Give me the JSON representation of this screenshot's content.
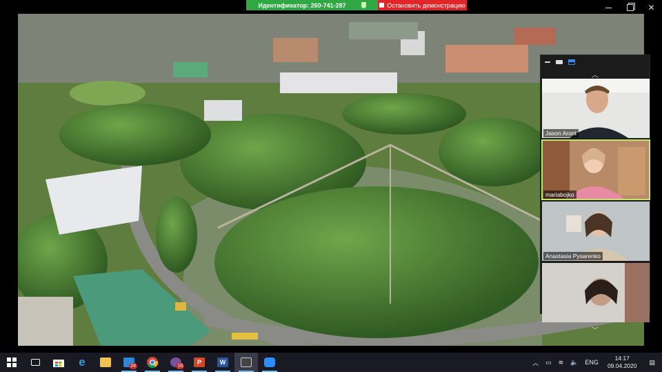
{
  "share_bar": {
    "id_label": "Идентификатор: 260-741-287",
    "stop_label": "Остановить демонстрацию"
  },
  "window_controls": [
    "minimize-icon",
    "restore-icon",
    "close-icon"
  ],
  "gallery": {
    "participants": [
      {
        "name": "Jason Aront",
        "active": false
      },
      {
        "name": "mariabojko",
        "active": true
      },
      {
        "name": "Anastasia Pysarenko",
        "active": false
      },
      {
        "name": "",
        "active": false
      }
    ]
  },
  "taskbar": {
    "apps": [
      {
        "name": "start-icon"
      },
      {
        "name": "task-view-icon"
      },
      {
        "name": "store-icon"
      },
      {
        "name": "edge-icon"
      },
      {
        "name": "file-explorer-icon"
      },
      {
        "name": "mail-icon",
        "badge": "24"
      },
      {
        "name": "chrome-icon"
      },
      {
        "name": "viber-icon",
        "badge": "18"
      },
      {
        "name": "powerpoint-icon"
      },
      {
        "name": "word-icon"
      },
      {
        "name": "media-player-icon"
      },
      {
        "name": "zoom-icon"
      }
    ],
    "language": "ENG",
    "time": "14:17",
    "date": "09.04.2020"
  }
}
